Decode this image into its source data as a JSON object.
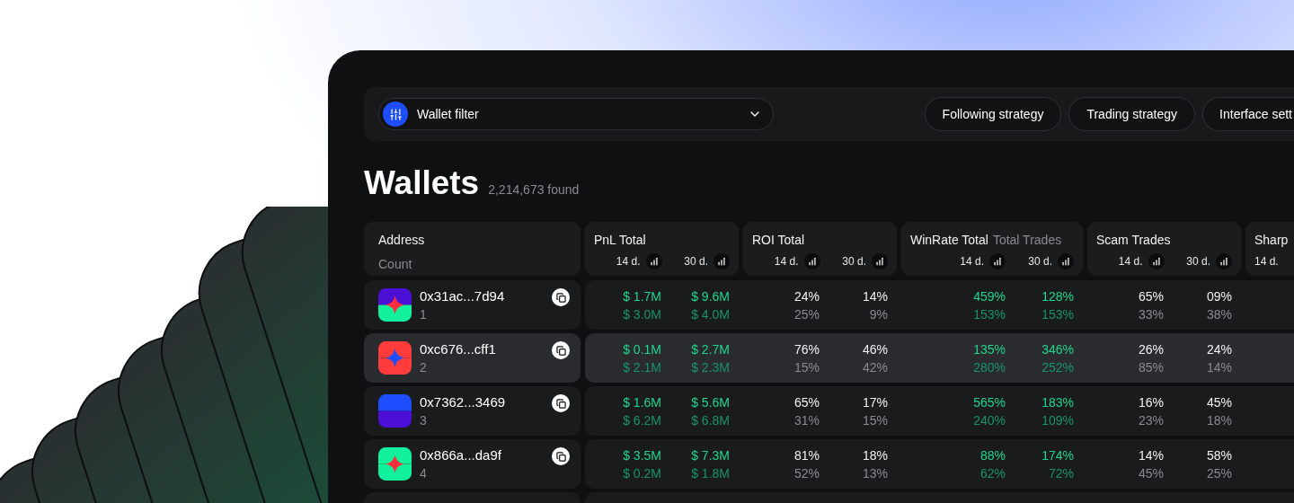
{
  "toolbar": {
    "filter": {
      "label": "Wallet filter"
    },
    "buttons": [
      "Following strategy",
      "Trading strategy",
      "Interface sett"
    ]
  },
  "title": "Wallets",
  "found": "2,214,673 found",
  "address_header": {
    "label": "Address",
    "sublabel": "Count"
  },
  "columns": [
    {
      "label": "PnL Total",
      "kind": "positive",
      "periods": [
        "14 d.",
        "30 d."
      ]
    },
    {
      "label": "ROI Total",
      "kind": "neutral",
      "periods": [
        "14 d.",
        "30 d."
      ]
    },
    {
      "label": "WinRate Total",
      "sublabel": "Total Trades",
      "kind": "positive",
      "periods": [
        "14 d.",
        "30 d."
      ]
    },
    {
      "label": "Scam Trades",
      "kind": "neutral",
      "periods": [
        "14 d.",
        "30 d."
      ]
    },
    {
      "label": "Sharp",
      "periods": [
        "14 d."
      ]
    }
  ],
  "rows": [
    {
      "address": "0x31ac...7d94",
      "count": "1",
      "selected": false,
      "avatar": [
        {
          "kind": "top",
          "color": "#4b0fd6"
        },
        {
          "kind": "bottom",
          "color": "#12f29c"
        },
        {
          "kind": "star",
          "color": "#ff2e3d"
        }
      ],
      "cells": [
        [
          [
            "$ 1.7M",
            "$ 3.0M"
          ],
          [
            "$ 9.6M",
            "$ 4.0M"
          ]
        ],
        [
          [
            "24%",
            "25%"
          ],
          [
            "14%",
            "9%"
          ]
        ],
        [
          [
            "459%",
            "153%"
          ],
          [
            "128%",
            "153%"
          ]
        ],
        [
          [
            "65%",
            "33%"
          ],
          [
            "09%",
            "38%"
          ]
        ]
      ]
    },
    {
      "address": "0xc676...cff1",
      "count": "2",
      "selected": true,
      "avatar": [
        {
          "kind": "top",
          "color": "#ff3b3b"
        },
        {
          "kind": "bottom",
          "color": "#ff3b3b"
        },
        {
          "kind": "star",
          "color": "#1e4dff"
        }
      ],
      "cells": [
        [
          [
            "$ 0.1M",
            "$ 2.1M"
          ],
          [
            "$ 2.7M",
            "$ 2.3M"
          ]
        ],
        [
          [
            "76%",
            "15%"
          ],
          [
            "46%",
            "42%"
          ]
        ],
        [
          [
            "135%",
            "280%"
          ],
          [
            "346%",
            "252%"
          ]
        ],
        [
          [
            "26%",
            "85%"
          ],
          [
            "24%",
            "14%"
          ]
        ]
      ]
    },
    {
      "address": "0x7362...3469",
      "count": "3",
      "selected": false,
      "avatar": [
        {
          "kind": "top",
          "color": "#1d4dff"
        },
        {
          "kind": "bottom",
          "color": "#4b0fd6"
        }
      ],
      "cells": [
        [
          [
            "$ 1.6M",
            "$ 6.2M"
          ],
          [
            "$ 5.6M",
            "$ 6.8M"
          ]
        ],
        [
          [
            "65%",
            "31%"
          ],
          [
            "17%",
            "15%"
          ]
        ],
        [
          [
            "565%",
            "240%"
          ],
          [
            "183%",
            "109%"
          ]
        ],
        [
          [
            "16%",
            "23%"
          ],
          [
            "45%",
            "18%"
          ]
        ]
      ]
    },
    {
      "address": "0x866a...da9f",
      "count": "4",
      "selected": false,
      "avatar": [
        {
          "kind": "top",
          "color": "#12f29c"
        },
        {
          "kind": "bottom",
          "color": "#12f29c"
        },
        {
          "kind": "star",
          "color": "#ff2e3d"
        }
      ],
      "cells": [
        [
          [
            "$ 3.5M",
            "$ 0.2M"
          ],
          [
            "$ 7.3M",
            "$ 1.8M"
          ]
        ],
        [
          [
            "81%",
            "52%"
          ],
          [
            "18%",
            "13%"
          ]
        ],
        [
          [
            "88%",
            "62%"
          ],
          [
            "174%",
            "72%"
          ]
        ],
        [
          [
            "14%",
            "45%"
          ],
          [
            "58%",
            "25%"
          ]
        ]
      ]
    }
  ]
}
